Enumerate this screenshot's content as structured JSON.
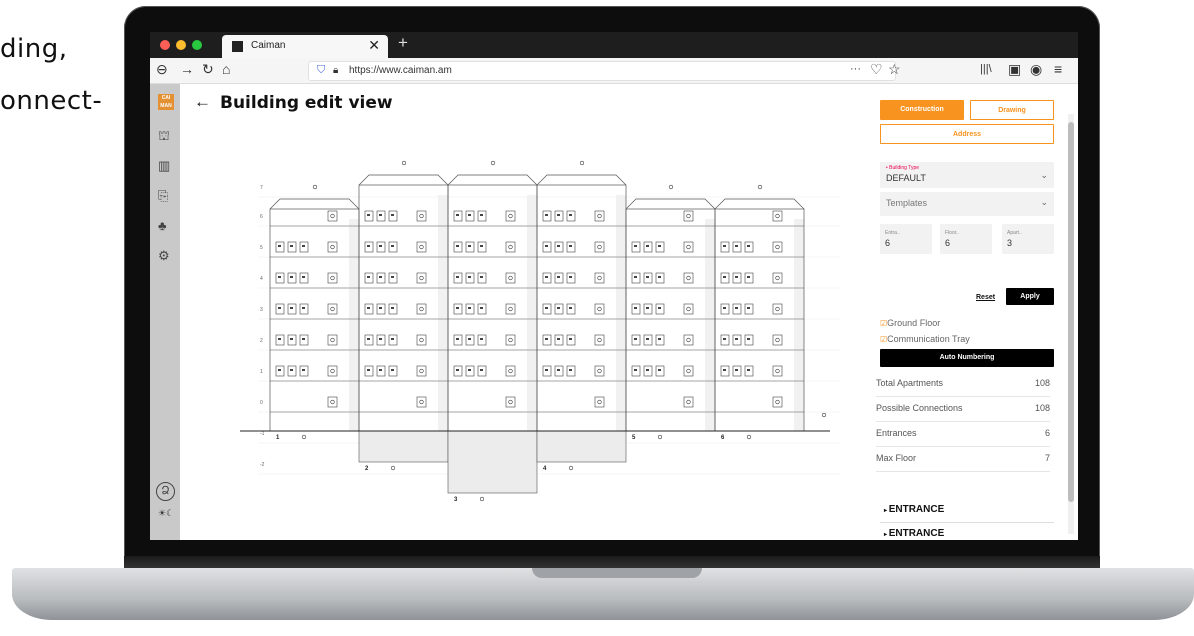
{
  "background_text": {
    "line1": "ding,",
    "line2": "onnect-"
  },
  "browser": {
    "tab_title": "Caiman",
    "url": "https://www.caiman.am",
    "close_glyph": "✕",
    "newtab_glyph": "+",
    "more_glyph": "···"
  },
  "sidebar": {
    "logo_text": "CAI MAN"
  },
  "page": {
    "back_glyph": "←",
    "title": "Building edit view"
  },
  "panel": {
    "tab_construction": "Construction",
    "tab_drawing": "Drawing",
    "tab_address": "Address",
    "building_type_label": "• Building Type",
    "building_type_value": "DEFAULT",
    "templates_label": "Templates",
    "entrances_label": "Entra..",
    "entrances_value": "6",
    "floors_label": "Floor..",
    "floors_value": "6",
    "apartments_label": "Apart..",
    "apartments_value": "3",
    "reset_label": "Reset",
    "apply_label": "Apply",
    "ground_floor_label": "Ground Floor",
    "communication_tray_label": "Communication Tray",
    "auto_numbering_label": "Auto Numbering",
    "stats": [
      {
        "label": "Total Apartments",
        "value": "108"
      },
      {
        "label": "Possible Connections",
        "value": "108"
      },
      {
        "label": "Entrances",
        "value": "6"
      },
      {
        "label": "Max Floor",
        "value": "7"
      }
    ],
    "entrance_label_1": "ENTRANCE",
    "entrance_label_2": "ENTRANCE"
  },
  "colors": {
    "accent": "#f7931e",
    "dark": "#000000",
    "sidebar": "#c9c9c9"
  },
  "building": {
    "floor_labels": [
      "7",
      "6",
      "5",
      "4",
      "3",
      "2",
      "1",
      "0",
      "-1",
      "-2"
    ],
    "entrance_numbers": [
      "1",
      "2",
      "3",
      "4",
      "5",
      "6"
    ]
  }
}
